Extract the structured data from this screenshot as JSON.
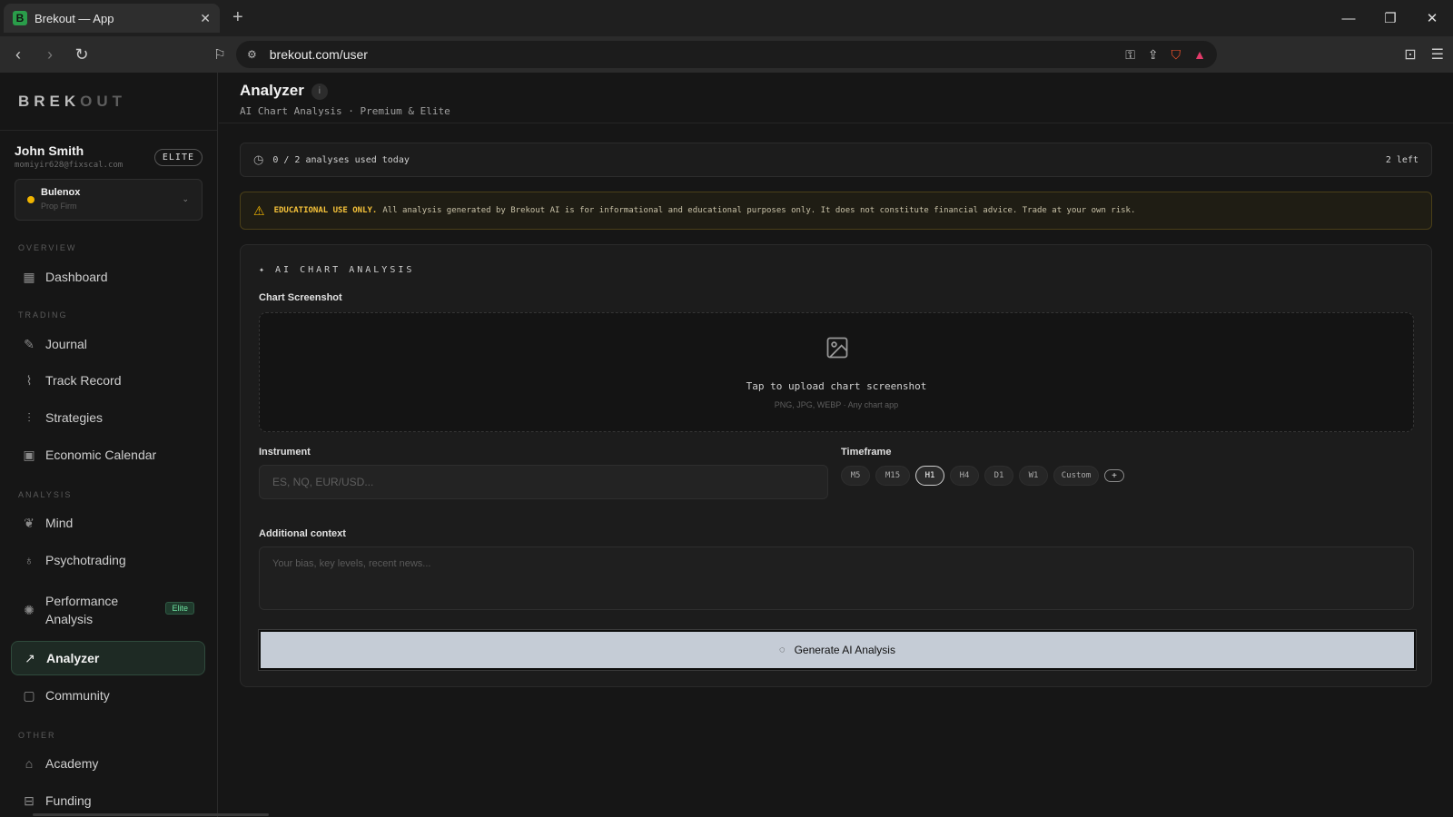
{
  "browser": {
    "tab_title": "Brekout — App",
    "tab_favicon": "B",
    "url": "brekout.com/user",
    "controls": {
      "minimize": "—",
      "restore": "❐",
      "close": "✕"
    }
  },
  "sidebar": {
    "brand_primary": "BREK",
    "brand_secondary": "OUT",
    "user": {
      "name": "John Smith",
      "email": "momiyir628@fixscal.com",
      "badge": "ELITE"
    },
    "firm": {
      "name": "Bulenox",
      "type": "Prop Firm",
      "status_color": "#f0b400"
    },
    "sections": {
      "overview": "OVERVIEW",
      "trading": "TRADING",
      "analysis": "ANALYSIS",
      "other": "OTHER"
    },
    "items": {
      "dashboard": {
        "label": "Dashboard",
        "icon": "grid-icon"
      },
      "journal": {
        "label": "Journal",
        "icon": "pen-icon"
      },
      "track_record": {
        "label": "Track Record",
        "icon": "pulse-icon"
      },
      "strategies": {
        "label": "Strategies",
        "icon": "signal-bars-icon"
      },
      "economic_calendar": {
        "label": "Economic Calendar",
        "icon": "calendar-icon"
      },
      "mind": {
        "label": "Mind",
        "icon": "brain-icon"
      },
      "psychotrading": {
        "label": "Psychotrading",
        "icon": "lightbulb-icon"
      },
      "performance_analysis": {
        "label": "Performance Analysis",
        "icon": "sun-icon",
        "tag": "Elite"
      },
      "analyzer": {
        "label": "Analyzer",
        "icon": "trend-up-icon"
      },
      "community": {
        "label": "Community",
        "icon": "chat-icon"
      },
      "academy": {
        "label": "Academy",
        "icon": "graduation-cap-icon"
      },
      "funding": {
        "label": "Funding",
        "icon": "briefcase-icon"
      }
    },
    "accent": "#2f4a3c"
  },
  "main": {
    "title": "Analyzer",
    "subtitle": "AI Chart Analysis · Premium & Elite",
    "usage": {
      "text": "0 / 2 analyses used today",
      "remaining": "2 left"
    },
    "warning": {
      "strong": "EDUCATIONAL USE ONLY.",
      "text": "All analysis generated by Brekout AI is for informational and educational purposes only. It does not constitute financial advice. Trade at your own risk.",
      "color": "#f5c23a"
    },
    "card": {
      "title": "✦ AI CHART ANALYSIS",
      "screenshot_label": "Chart Screenshot",
      "upload_text": "Tap to upload chart screenshot",
      "upload_sub": "PNG, JPG, WEBP · Any chart app",
      "instrument_label": "Instrument",
      "instrument_placeholder": "ES, NQ, EUR/USD...",
      "timeframe_label": "Timeframe",
      "timeframes": [
        "M5",
        "M15",
        "H1",
        "H4",
        "D1",
        "W1",
        "Custom"
      ],
      "timeframe_selected": "H1",
      "timeframe_add": "+",
      "context_label": "Additional context",
      "context_placeholder": "Your bias, key levels, recent news...",
      "generate_label": "Generate AI Analysis"
    }
  }
}
